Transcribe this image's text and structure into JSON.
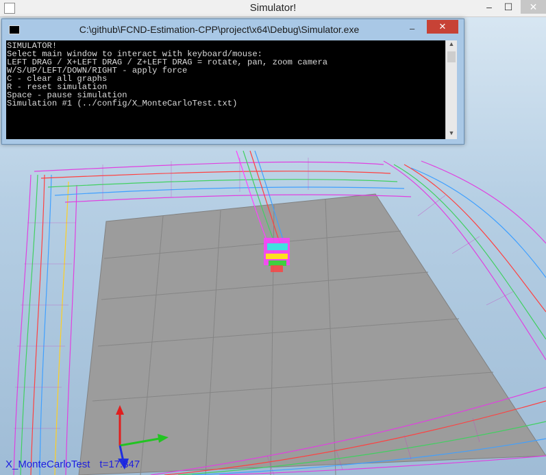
{
  "window": {
    "title": "Simulator!",
    "minimize": "–",
    "maximize": "☐",
    "close": "✕"
  },
  "console": {
    "title": "C:\\github\\FCND-Estimation-CPP\\project\\x64\\Debug\\Simulator.exe",
    "minimize": "–",
    "close": "✕",
    "lines": [
      "SIMULATOR!",
      "Select main window to interact with keyboard/mouse:",
      "LEFT DRAG / X+LEFT DRAG / Z+LEFT DRAG = rotate, pan, zoom camera",
      "W/S/UP/LEFT/DOWN/RIGHT - apply force",
      "C - clear all graphs",
      "R - reset simulation",
      "Space - pause simulation",
      "Simulation #1 (../config/X_MonteCarloTest.txt)"
    ]
  },
  "status": {
    "scenario": "X_MonteCarloTest",
    "time": "t=17.847"
  },
  "icons": {
    "app": "app-window-icon",
    "console": "console-icon",
    "axes": "xyz-axes-icon"
  },
  "colors": {
    "floor": "#9a9a9a",
    "status_text": "#1d1de0",
    "close_red": "#c74236",
    "axis_x": "#22c422",
    "axis_y": "#e01e1e",
    "axis_z": "#1e2ee0"
  }
}
